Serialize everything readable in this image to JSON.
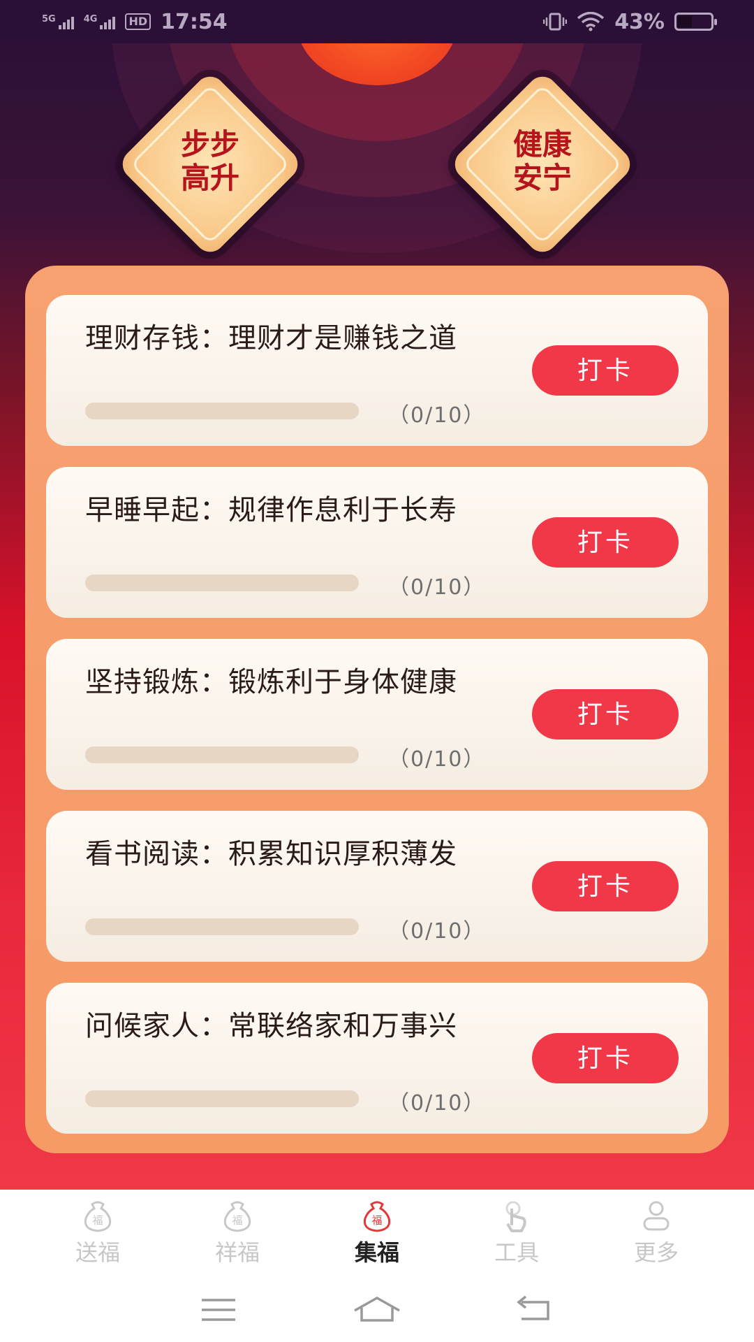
{
  "status_bar": {
    "net1": "5G",
    "net2": "4G",
    "hd": "HD",
    "time": "17:54",
    "battery": "43%",
    "battery_level": 0.43
  },
  "hero": {
    "left_badge": "步步\n高升",
    "left_line1": "步步",
    "left_line2": "高升",
    "right_line1": "健康",
    "right_line2": "安宁"
  },
  "tasks": [
    {
      "title": "理财存钱：理财才是赚钱之道",
      "count": "（0/10）",
      "progress": 0,
      "button": "打卡"
    },
    {
      "title": "早睡早起：规律作息利于长寿",
      "count": "（0/10）",
      "progress": 0,
      "button": "打卡"
    },
    {
      "title": "坚持锻炼：锻炼利于身体健康",
      "count": "（0/10）",
      "progress": 0,
      "button": "打卡"
    },
    {
      "title": "看书阅读：积累知识厚积薄发",
      "count": "（0/10）",
      "progress": 0,
      "button": "打卡"
    },
    {
      "title": "问候家人：常联络家和万事兴",
      "count": "（0/10）",
      "progress": 0,
      "button": "打卡"
    }
  ],
  "bottom_nav": [
    {
      "label": "送福",
      "icon": "fu-bag-icon",
      "active": false
    },
    {
      "label": "祥福",
      "icon": "fu-bag-icon",
      "active": false
    },
    {
      "label": "集福",
      "icon": "fu-bag-icon",
      "active": true
    },
    {
      "label": "工具",
      "icon": "tap-hand-icon",
      "active": false
    },
    {
      "label": "更多",
      "icon": "user-icon",
      "active": false
    }
  ],
  "fu_char": "福",
  "colors": {
    "accent": "#f03848",
    "panel": "#f7a070",
    "badge_text": "#b6141c"
  }
}
